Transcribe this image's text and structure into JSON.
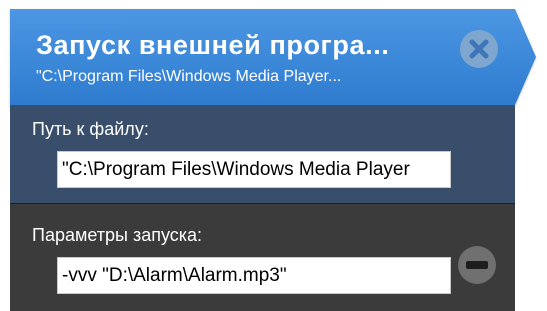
{
  "header": {
    "title": "Запуск внешней програ...",
    "subtitle": "\"C:\\Program Files\\Windows Media Player...",
    "close_icon": "close-icon",
    "accent_color": "#3583d6"
  },
  "path_section": {
    "label": "Путь к файлу:",
    "value": "\"C:\\Program Files\\Windows Media Player"
  },
  "params_section": {
    "label": "Параметры запуска:",
    "value": "-vvv \"D:\\Alarm\\Alarm.mp3\"",
    "remove_icon": "minus-icon"
  }
}
